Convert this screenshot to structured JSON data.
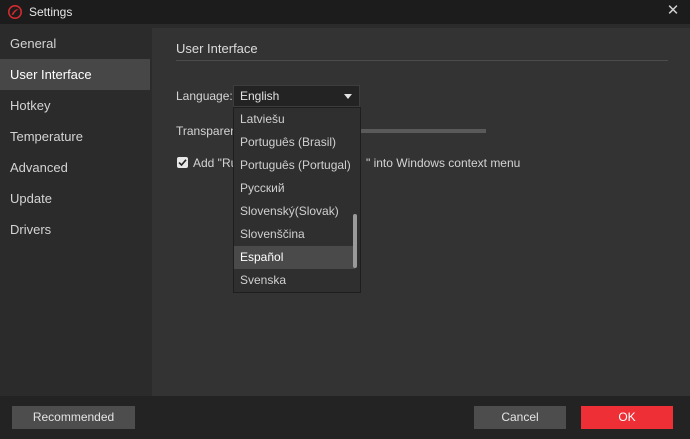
{
  "window": {
    "title": "Settings",
    "logo_icon": "app-logo-icon",
    "close_icon": "close-icon",
    "close_glyph": "✕"
  },
  "sidebar": {
    "items": [
      {
        "label": "General"
      },
      {
        "label": "User Interface"
      },
      {
        "label": "Hotkey"
      },
      {
        "label": "Temperature"
      },
      {
        "label": "Advanced"
      },
      {
        "label": "Update"
      },
      {
        "label": "Drivers"
      }
    ],
    "active_index": 1
  },
  "main": {
    "section_title": "User Interface",
    "language": {
      "label": "Language:",
      "selected": "English"
    },
    "transparency": {
      "label": "Transparenc"
    },
    "context_menu": {
      "checked": true,
      "text_before": "Add \"Ru",
      "text_after": "\" into Windows context menu"
    }
  },
  "language_dropdown": {
    "options": [
      "Latviešu",
      "Português (Brasil)",
      "Português (Portugal)",
      "Русский",
      "Slovenský(Slovak)",
      "Slovenščina",
      "Español",
      "Svenska"
    ],
    "highlighted_index": 6
  },
  "footer": {
    "recommended": "Recommended",
    "cancel": "Cancel",
    "ok": "OK"
  },
  "colors": {
    "accent": "#ee2f35",
    "active_nav": "#474747",
    "background": "#2b2b2b",
    "panel": "#333333"
  }
}
